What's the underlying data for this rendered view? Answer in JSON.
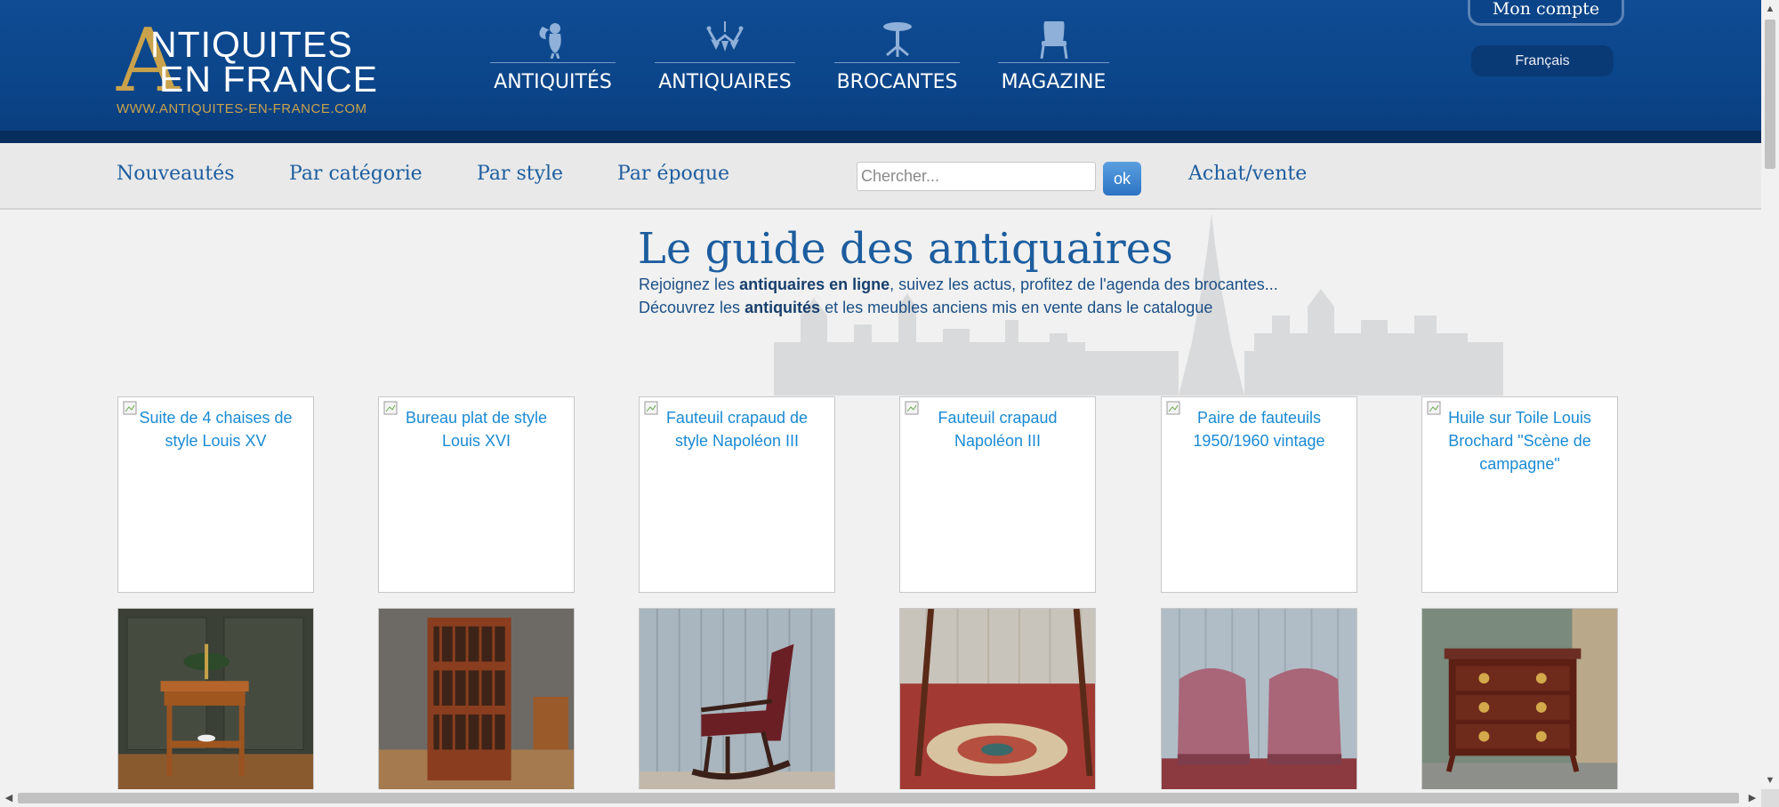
{
  "brand": {
    "logo_initial": "A",
    "logo_line1": "NTIQUITES",
    "logo_line2": "EN FRANCE",
    "logo_url": "WWW.ANTIQUITES-EN-FRANCE.COM",
    "gold_color": "#c9a24b",
    "header_color": "#0b4488"
  },
  "main_nav": [
    {
      "label": "ANTIQUITÉS",
      "icon": "cherub-icon"
    },
    {
      "label": "ANTIQUAIRES",
      "icon": "chandelier-icon"
    },
    {
      "label": "BROCANTES",
      "icon": "pedestal-table-icon"
    },
    {
      "label": "MAGAZINE",
      "icon": "armchair-icon"
    }
  ],
  "account": {
    "label": "Mon compte"
  },
  "language": {
    "label": "Français"
  },
  "sub_nav": [
    {
      "label": "Nouveautés"
    },
    {
      "label": "Par catégorie"
    },
    {
      "label": "Par style"
    },
    {
      "label": "Par époque"
    }
  ],
  "search": {
    "placeholder": "Chercher...",
    "button_label": "ok"
  },
  "buy_sell": {
    "label": "Achat/vente"
  },
  "hero": {
    "title": "Le guide des antiquaires",
    "line1_before": "Rejoignez les ",
    "line1_bold": "antiquaires en ligne",
    "line1_after": ", suivez les actus, profitez de l'agenda des brocantes...",
    "line2_before": "Découvrez les ",
    "line2_bold": "antiquités",
    "line2_after": " et les meubles anciens mis en vente dans le catalogue"
  },
  "products": [
    {
      "alt": "Suite de 4 chaises de style Louis XV"
    },
    {
      "alt": "Bureau plat de style Louis XVI"
    },
    {
      "alt": "Fauteuil crapaud de style Napoléon III"
    },
    {
      "alt": "Fauteuil crapaud Napoléon III"
    },
    {
      "alt": "Paire de fauteuils 1950/1960 vintage"
    },
    {
      "alt": "Huile sur Toile Louis Brochard \"Scène de campagne\""
    }
  ],
  "photos": [
    {
      "subject": "side-table-with-lamp"
    },
    {
      "subject": "revolving-bookcase"
    },
    {
      "subject": "rocking-chair"
    },
    {
      "subject": "table-on-carpet"
    },
    {
      "subject": "pair-of-pink-armchairs"
    },
    {
      "subject": "marquetry-commode"
    }
  ]
}
